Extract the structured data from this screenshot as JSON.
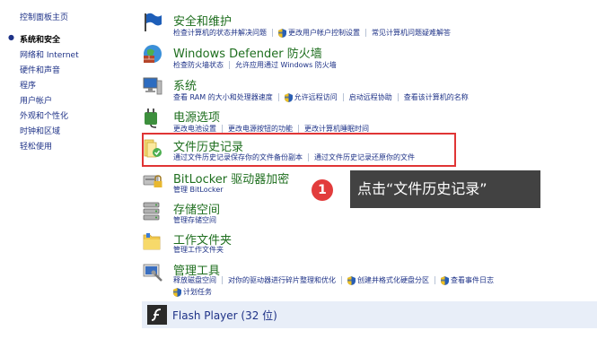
{
  "sidebar": {
    "items": [
      {
        "label": "控制面板主页",
        "active": false
      },
      {
        "label": "系统和安全",
        "active": true
      },
      {
        "label": "网络和 Internet",
        "active": false
      },
      {
        "label": "硬件和声音",
        "active": false
      },
      {
        "label": "程序",
        "active": false
      },
      {
        "label": "用户帐户",
        "active": false
      },
      {
        "label": "外观和个性化",
        "active": false
      },
      {
        "label": "时钟和区域",
        "active": false
      },
      {
        "label": "轻松使用",
        "active": false
      }
    ]
  },
  "categories": [
    {
      "title": "安全和维护",
      "icon": "flag-icon",
      "links": [
        "检查计算机的状态并解决问题",
        "更改用户帐户控制设置",
        "常见计算机问题疑难解答"
      ]
    },
    {
      "title": "Windows Defender 防火墙",
      "icon": "firewall-icon",
      "links": [
        "检查防火墙状态",
        "允许应用通过 Windows 防火墙"
      ]
    },
    {
      "title": "系统",
      "icon": "computer-icon",
      "links": [
        "查看 RAM 的大小和处理器速度",
        "允许远程访问",
        "启动远程协助",
        "查看该计算机的名称"
      ]
    },
    {
      "title": "电源选项",
      "icon": "power-icon",
      "links": [
        "更改电池设置",
        "更改电源按钮的功能",
        "更改计算机睡眠时间"
      ]
    },
    {
      "title": "文件历史记录",
      "icon": "file-history-icon",
      "links": [
        "通过文件历史记录保存你的文件备份副本",
        "通过文件历史记录还原你的文件"
      ]
    },
    {
      "title": "BitLocker 驱动器加密",
      "icon": "bitlocker-icon",
      "links": [
        "管理 BitLocker"
      ]
    },
    {
      "title": "存储空间",
      "icon": "storage-icon",
      "links": [
        "管理存储空间"
      ]
    },
    {
      "title": "工作文件夹",
      "icon": "work-folder-icon",
      "links": [
        "管理工作文件夹"
      ]
    },
    {
      "title": "管理工具",
      "icon": "admin-tools-icon",
      "links": [
        "释放磁盘空间",
        "对你的驱动器进行碎片整理和优化",
        "创建并格式化硬盘分区",
        "查看事件日志",
        "计划任务"
      ]
    }
  ],
  "flash": {
    "label": "Flash Player (32 位)"
  },
  "callout": {
    "number": "1",
    "text": "点击“文件历史记录”"
  },
  "colors": {
    "highlight": "#e03535",
    "link": "#1e3287",
    "title": "#1e6e1e",
    "badge": "#e23c3c"
  }
}
